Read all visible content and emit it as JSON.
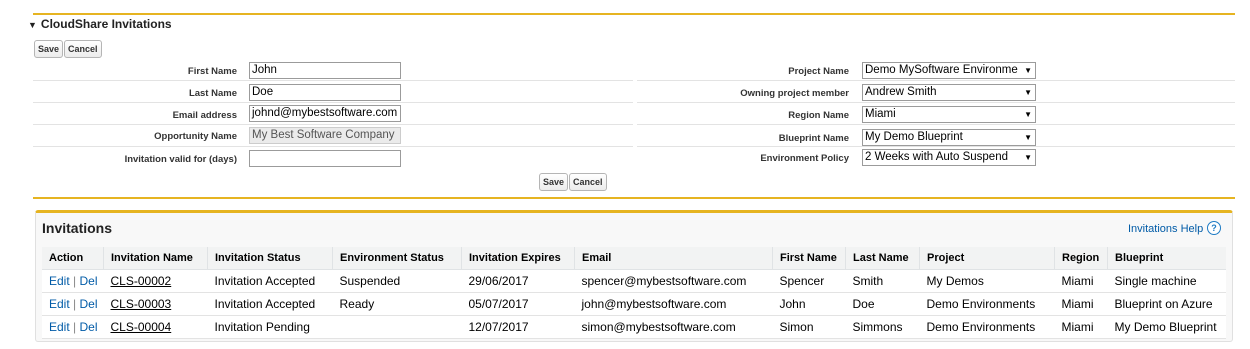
{
  "section": {
    "title": "CloudShare Invitations",
    "toggle_icon": "triangle-down-icon"
  },
  "buttons": {
    "save": "Save",
    "cancel": "Cancel"
  },
  "form_left": [
    {
      "label": "First Name",
      "value": "John",
      "readonly": false
    },
    {
      "label": "Last Name",
      "value": "Doe",
      "readonly": false
    },
    {
      "label": "Email address",
      "value": "johnd@mybestsoftware.com",
      "readonly": false
    },
    {
      "label": "Opportunity Name",
      "value": "My Best Software Company",
      "readonly": true
    },
    {
      "label": "Invitation valid for (days)",
      "value": "",
      "readonly": false
    }
  ],
  "form_right": [
    {
      "label": "Project Name",
      "value": "Demo MySoftware Environme"
    },
    {
      "label": "Owning project member",
      "value": "Andrew Smith"
    },
    {
      "label": "Region Name",
      "value": "Miami"
    },
    {
      "label": "Blueprint Name",
      "value": "My Demo Blueprint"
    },
    {
      "label": "Environment Policy",
      "value": "2 Weeks with Auto Suspend"
    }
  ],
  "invitations": {
    "title": "Invitations",
    "help_link": "Invitations Help",
    "help_icon": "question-icon",
    "columns": [
      "Action",
      "Invitation Name",
      "Invitation Status",
      "Environment Status",
      "Invitation Expires",
      "Email",
      "First Name",
      "Last Name",
      "Project",
      "Region",
      "Blueprint"
    ],
    "rows": [
      {
        "edit": "Edit",
        "del": "Del",
        "name": "CLS-00002",
        "status": "Invitation Accepted",
        "env_status": "Suspended",
        "expires": "29/06/2017",
        "email": "spencer@mybestsoftware.com",
        "first": "Spencer",
        "last": "Smith",
        "project": "My Demos",
        "region": "Miami",
        "blueprint": "Single machine"
      },
      {
        "edit": "Edit",
        "del": "Del",
        "name": "CLS-00003",
        "status": "Invitation Accepted",
        "env_status": "Ready",
        "expires": "05/07/2017",
        "email": "john@mybestsoftware.com",
        "first": "John",
        "last": "Doe",
        "project": "Demo Environments",
        "region": "Miami",
        "blueprint": "Blueprint on Azure"
      },
      {
        "edit": "Edit",
        "del": "Del",
        "name": "CLS-00004",
        "status": "Invitation Pending",
        "env_status": "",
        "expires": "12/07/2017",
        "email": "simon@mybestsoftware.com",
        "first": "Simon",
        "last": "Simmons",
        "project": "Demo Environments",
        "region": "Miami",
        "blueprint": "My Demo Blueprint"
      }
    ]
  },
  "colors": {
    "accent": "#e6b421",
    "link": "#015ba7"
  }
}
